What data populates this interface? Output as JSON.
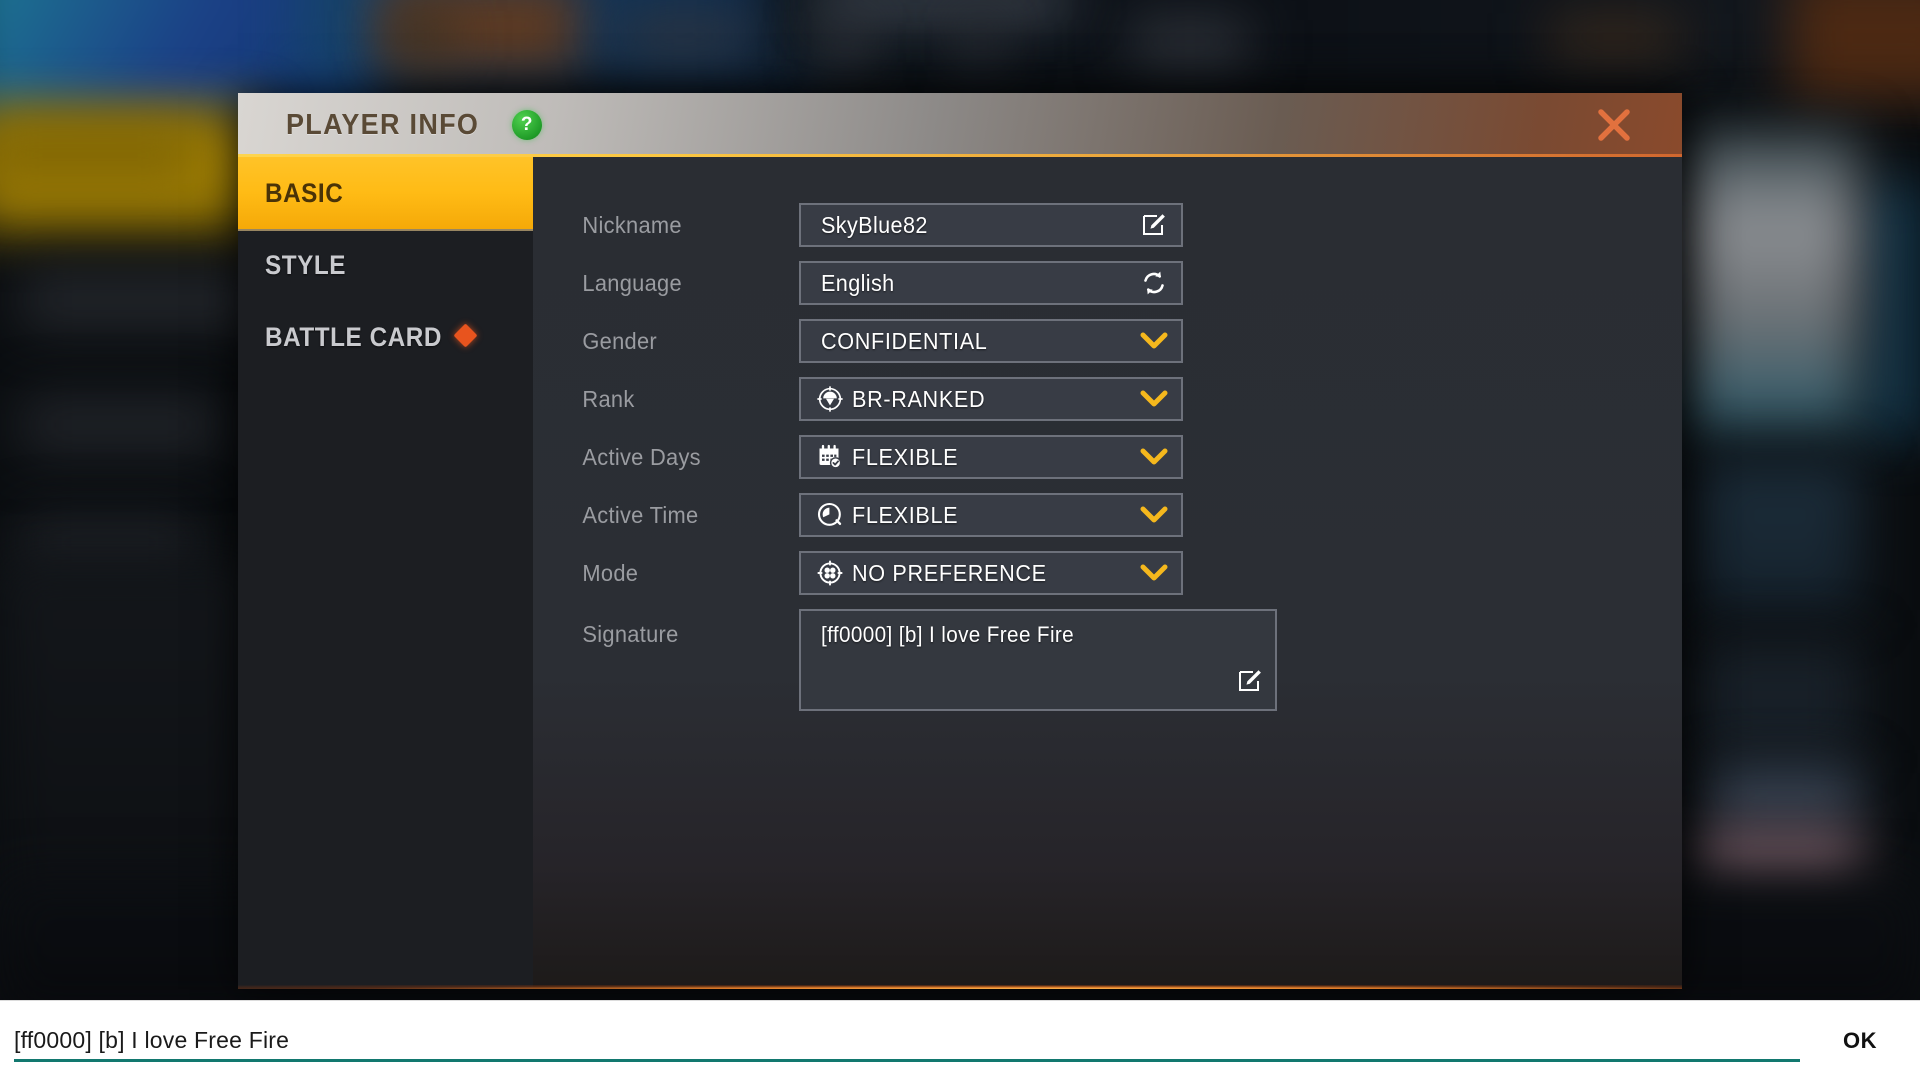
{
  "dialog": {
    "title": "PLAYER INFO",
    "help_icon_label": "?",
    "close_icon": "close-x-icon"
  },
  "sidebar": {
    "items": [
      {
        "label": "BASIC",
        "active": true,
        "badge": false
      },
      {
        "label": "STYLE",
        "active": false,
        "badge": false
      },
      {
        "label": "BATTLE CARD",
        "active": false,
        "badge": true
      }
    ]
  },
  "form": {
    "fields": [
      {
        "label": "Nickname",
        "value": "SkyBlue82",
        "lead_icon": null,
        "tail_icon": "edit-pencil-icon"
      },
      {
        "label": "Language",
        "value": "English",
        "lead_icon": null,
        "tail_icon": "refresh-sync-icon"
      },
      {
        "label": "Gender",
        "value": "CONFIDENTIAL",
        "lead_icon": null,
        "tail_icon": "chevron-down-icon"
      },
      {
        "label": "Rank",
        "value": "BR-RANKED",
        "lead_icon": "parachute-rank-icon",
        "tail_icon": "chevron-down-icon"
      },
      {
        "label": "Active Days",
        "value": "FLEXIBLE",
        "lead_icon": "calendar-check-icon",
        "tail_icon": "chevron-down-icon"
      },
      {
        "label": "Active Time",
        "value": "FLEXIBLE",
        "lead_icon": "clock-icon",
        "tail_icon": "chevron-down-icon"
      },
      {
        "label": "Mode",
        "value": "NO PREFERENCE",
        "lead_icon": "squad-mode-icon",
        "tail_icon": "chevron-down-icon"
      }
    ],
    "signature": {
      "label": "Signature",
      "value": "[ff0000] [b] I love Free Fire",
      "edit_icon": "edit-pencil-icon"
    }
  },
  "ime_bar": {
    "input_value": "[ff0000] [b] I love Free Fire",
    "input_placeholder": "",
    "ok_label": "OK"
  },
  "colors": {
    "accent_amber": "#ffc328",
    "accent_orange": "#e8541e",
    "close_orange": "#e2713e",
    "badge_green": "#2ca02c",
    "ime_underline_teal": "#12786f",
    "field_bg": "#383c45",
    "field_border": "#6d717b",
    "sidebar_bg": "#1c1e22"
  }
}
